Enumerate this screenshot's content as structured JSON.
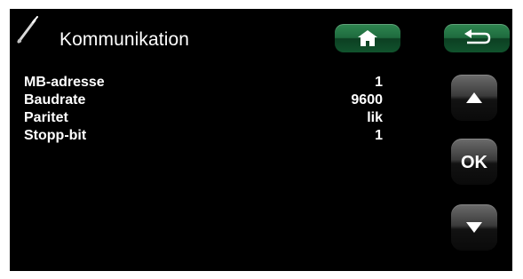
{
  "header": {
    "title": "Kommunikation",
    "icon": "wrench-icon",
    "buttons": [
      {
        "name": "home",
        "icon": "home-icon",
        "color": "#1e6b3e"
      },
      {
        "name": "back",
        "icon": "back-arrow-icon",
        "color": "#1e6b3e"
      }
    ]
  },
  "settings": [
    {
      "label": "MB-adresse",
      "value": "1"
    },
    {
      "label": "Baudrate",
      "value": "9600"
    },
    {
      "label": "Paritet",
      "value": "lik"
    },
    {
      "label": "Stopp-bit",
      "value": "1"
    }
  ],
  "controls": {
    "up_icon": "arrow-up-icon",
    "ok_label": "OK",
    "down_icon": "arrow-down-icon"
  },
  "colors": {
    "background": "#000000",
    "text": "#ffffff",
    "accent_green": "#1e6b3e"
  }
}
